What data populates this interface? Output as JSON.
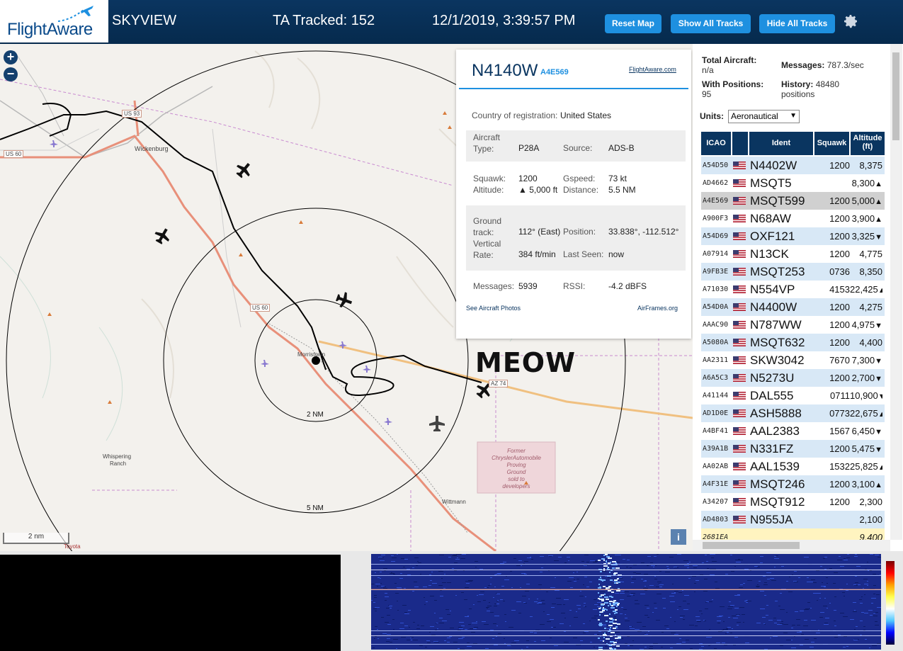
{
  "header": {
    "logo_text": "FlightAware",
    "app_name": "SKYVIEW",
    "tracked": "TA Tracked: 152",
    "datetime": "12/1/2019, 3:39:57 PM",
    "buttons": {
      "reset": "Reset Map",
      "show": "Show All Tracks",
      "hide": "Hide All Tracks"
    }
  },
  "map": {
    "zoom_in": "+",
    "zoom_out": "−",
    "scale_label": "2 nm",
    "info_label": "i",
    "overlay_text": "MEOW",
    "labels": {
      "wickenburg": "Wickenburg",
      "us93": "US 93",
      "us60a": "US 60",
      "us60b": "US 60",
      "az74": "AZ 74",
      "morristown": "Morristown",
      "ring2": "2 NM",
      "ring5": "5 NM",
      "whispering": "Whispering",
      "ranch": "Ranch",
      "wittmann": "Wittmann",
      "chrysler": [
        "Former",
        "ChryslerAutomobile",
        "Proving",
        "Ground",
        "sold to",
        "developers"
      ],
      "toyota": "Toyota"
    }
  },
  "popup": {
    "registration": "N4140W",
    "hex": "A4E569",
    "fa_link": "FlightAware.com",
    "country_label": "Country of registration:",
    "country_value": "United States",
    "aircraft_type_label": [
      "Aircraft",
      "Type:"
    ],
    "aircraft_type_value": "P28A",
    "source_label": "Source:",
    "source_value": "ADS-B",
    "squawk_label": "Squawk:",
    "squawk_value": "1200",
    "gspeed_label": "Gspeed:",
    "gspeed_value": "73 kt",
    "altitude_label": "Altitude:",
    "altitude_value": "▲ 5,000 ft",
    "distance_label": "Distance:",
    "distance_value": "5.5 NM",
    "track_label": [
      "Ground",
      "track:"
    ],
    "track_value": "112° (East)",
    "position_label": "Position:",
    "position_value": "33.838°, -112.512°",
    "vrate_label": [
      "Vertical",
      "Rate:"
    ],
    "vrate_value": "384 ft/min",
    "lastseen_label": "Last Seen:",
    "lastseen_value": "now",
    "messages_label": "Messages:",
    "messages_value": "5939",
    "rssi_label": "RSSI:",
    "rssi_value": "-4.2 dBFS",
    "photos_link": "See Aircraft Photos",
    "airframes_link": "AirFrames.org"
  },
  "side": {
    "total_label": "Total Aircraft:",
    "total_value": "n/a",
    "messages_label": "Messages:",
    "messages_value": "787.3/sec",
    "positions_label": "With Positions:",
    "positions_value": "95",
    "history_label": "History:",
    "history_value": "48480",
    "history_unit": "positions",
    "units_label": "Units:",
    "units_value": "Aeronautical",
    "columns": {
      "icao": "ICAO",
      "ident": "Ident",
      "squawk": "Squawk",
      "altitude": "Altitude",
      "altitude_unit": "(ft)"
    },
    "rows": [
      {
        "icao": "A54D50",
        "ident": "N4402W",
        "squawk": "1200",
        "alt": "8,375",
        "trend": ""
      },
      {
        "icao": "AD4662",
        "ident": "MSQT5",
        "squawk": "",
        "alt": "8,300",
        "trend": "▲"
      },
      {
        "icao": "A4E569",
        "ident": "MSQT599",
        "squawk": "1200",
        "alt": "5,000",
        "trend": "▲"
      },
      {
        "icao": "A900F3",
        "ident": "N68AW",
        "squawk": "1200",
        "alt": "3,900",
        "trend": "▲"
      },
      {
        "icao": "A54D69",
        "ident": "OXF121",
        "squawk": "1200",
        "alt": "3,325",
        "trend": "▼"
      },
      {
        "icao": "A07914",
        "ident": "N13CK",
        "squawk": "1200",
        "alt": "4,775",
        "trend": ""
      },
      {
        "icao": "A9FB3E",
        "ident": "MSQT253",
        "squawk": "0736",
        "alt": "8,350",
        "trend": ""
      },
      {
        "icao": "A71030",
        "ident": "N554VP",
        "squawk": "4153",
        "alt": "22,425",
        "trend": "▲"
      },
      {
        "icao": "A54D0A",
        "ident": "N4400W",
        "squawk": "1200",
        "alt": "4,275",
        "trend": ""
      },
      {
        "icao": "AAAC90",
        "ident": "N787WW",
        "squawk": "1200",
        "alt": "4,975",
        "trend": "▼"
      },
      {
        "icao": "A5080A",
        "ident": "MSQT632",
        "squawk": "1200",
        "alt": "4,400",
        "trend": ""
      },
      {
        "icao": "AA2311",
        "ident": "SKW3042",
        "squawk": "7670",
        "alt": "7,300",
        "trend": "▼"
      },
      {
        "icao": "A6A5C3",
        "ident": "N5273U",
        "squawk": "1200",
        "alt": "2,700",
        "trend": "▼"
      },
      {
        "icao": "A41144",
        "ident": "DAL555",
        "squawk": "0711",
        "alt": "10,900",
        "trend": "▼"
      },
      {
        "icao": "AD1D0E",
        "ident": "ASH5888",
        "squawk": "0773",
        "alt": "22,675",
        "trend": "▲"
      },
      {
        "icao": "A4BF41",
        "ident": "AAL2383",
        "squawk": "1567",
        "alt": "6,450",
        "trend": "▼"
      },
      {
        "icao": "A39A1B",
        "ident": "N331FZ",
        "squawk": "1200",
        "alt": "5,475",
        "trend": "▼"
      },
      {
        "icao": "AA02AB",
        "ident": "AAL1539",
        "squawk": "1532",
        "alt": "25,825",
        "trend": "▲"
      },
      {
        "icao": "A4F31E",
        "ident": "MSQT246",
        "squawk": "1200",
        "alt": "3,100",
        "trend": "▲"
      },
      {
        "icao": "A34207",
        "ident": "MSQT912",
        "squawk": "1200",
        "alt": "2,300",
        "trend": ""
      },
      {
        "icao": "AD4803",
        "ident": "N955JA",
        "squawk": "",
        "alt": "2,100",
        "trend": ""
      },
      {
        "icao": "2681EA",
        "ident": "",
        "squawk": "",
        "alt": "9,400",
        "trend": ""
      }
    ]
  },
  "colors": {
    "header": "#0a3560",
    "button": "#1e90e0",
    "row_even": "#d8e8f6",
    "row_selected": "#d0d0d0",
    "row_mlat": "#fff4c0"
  }
}
